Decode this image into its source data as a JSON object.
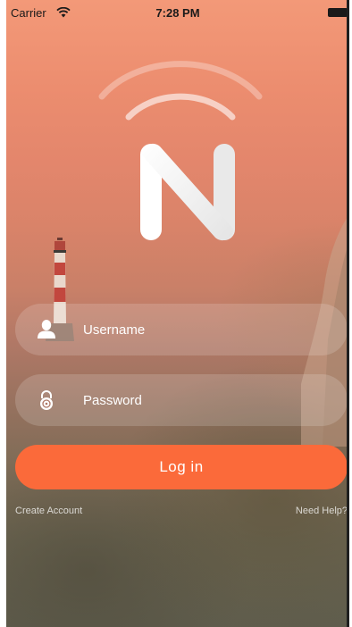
{
  "status_bar": {
    "carrier": "Carrier",
    "time": "7:28 PM",
    "wifi_icon": "wifi-icon",
    "battery_icon": "battery-icon"
  },
  "branding": {
    "logo_icon": "n-logo-icon",
    "signal_icon": "signal-arcs-icon"
  },
  "login_form": {
    "username": {
      "placeholder": "Username",
      "value": "",
      "icon": "user-icon"
    },
    "password": {
      "placeholder": "Password",
      "value": "",
      "icon": "lock-icon"
    },
    "login_label": "Log in"
  },
  "links": {
    "create_account": "Create Account",
    "need_help": "Need Help?"
  },
  "colors": {
    "accent": "#fb6a3a",
    "background_top": "#f39978",
    "background_bottom": "#5f5d4d",
    "text": "#ffffff"
  }
}
